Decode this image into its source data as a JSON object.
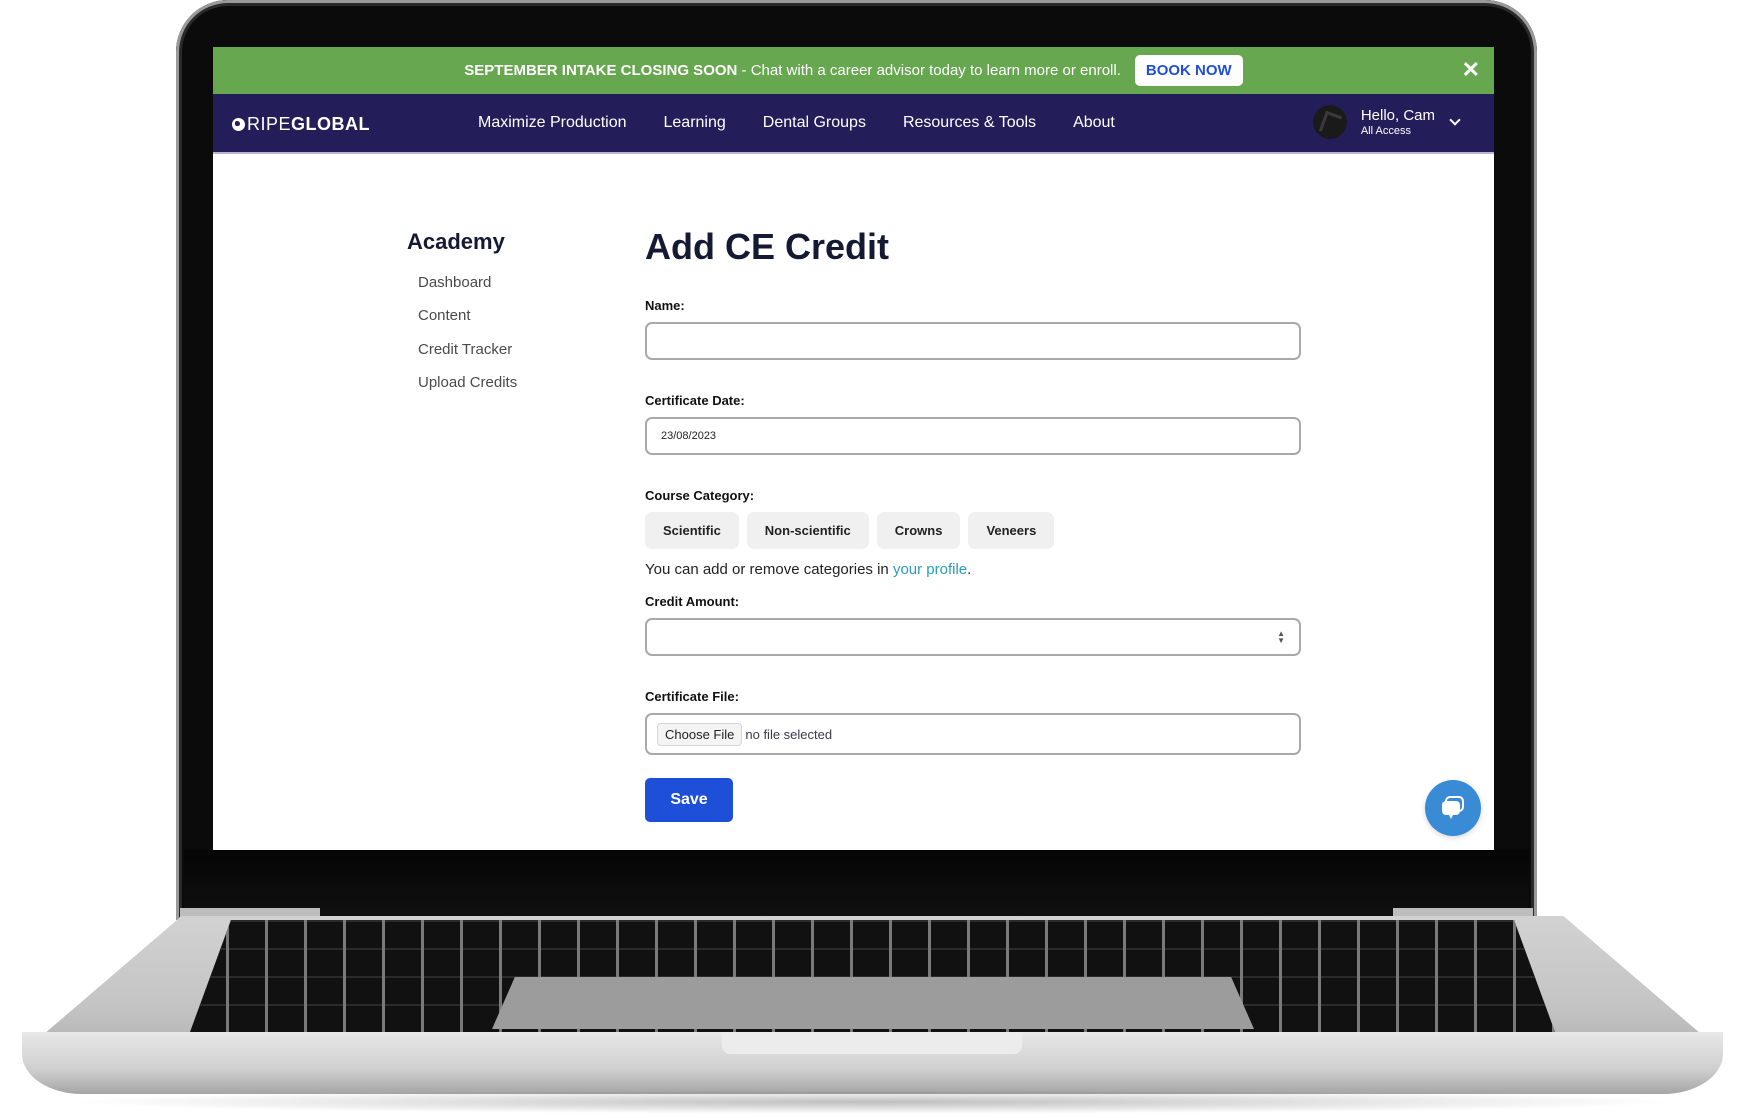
{
  "promo": {
    "headline": "SEPTEMBER INTAKE CLOSING SOON",
    "message": " - Chat with a career advisor today to learn more or enroll.",
    "cta_label": "BOOK NOW",
    "close_glyph": "✕",
    "color": "#67a74f"
  },
  "nav": {
    "logo_light": "RIPE",
    "logo_bold": "GLOBAL",
    "links": [
      {
        "label": "Maximize Production"
      },
      {
        "label": "Learning"
      },
      {
        "label": "Dental Groups"
      },
      {
        "label": "Resources & Tools"
      },
      {
        "label": "About"
      }
    ],
    "user": {
      "greeting": "Hello, Cam",
      "plan": "All Access"
    },
    "color": "#231e5a"
  },
  "sidebar": {
    "title": "Academy",
    "items": [
      {
        "label": "Dashboard"
      },
      {
        "label": "Content"
      },
      {
        "label": "Credit Tracker"
      },
      {
        "label": "Upload Credits"
      }
    ]
  },
  "form": {
    "title": "Add CE Credit",
    "name": {
      "label": "Name:",
      "value": ""
    },
    "certificate_date": {
      "label": "Certificate Date:",
      "value": "23/08/2023"
    },
    "course_category": {
      "label": "Course Category:",
      "options": [
        {
          "label": "Scientific"
        },
        {
          "label": "Non-scientific"
        },
        {
          "label": "Crowns"
        },
        {
          "label": "Veneers"
        }
      ],
      "help_prefix": "You can add or remove categories in ",
      "help_link": "your profile",
      "help_suffix": "."
    },
    "credit_amount": {
      "label": "Credit Amount:",
      "value": ""
    },
    "certificate_file": {
      "label": "Certificate File:",
      "button_label": "Choose File",
      "status": "no file selected"
    },
    "save_label": "Save",
    "save_color": "#1e4fd8"
  },
  "chat": {
    "icon": "chat-bubble-icon",
    "color": "#3a8bd6"
  }
}
